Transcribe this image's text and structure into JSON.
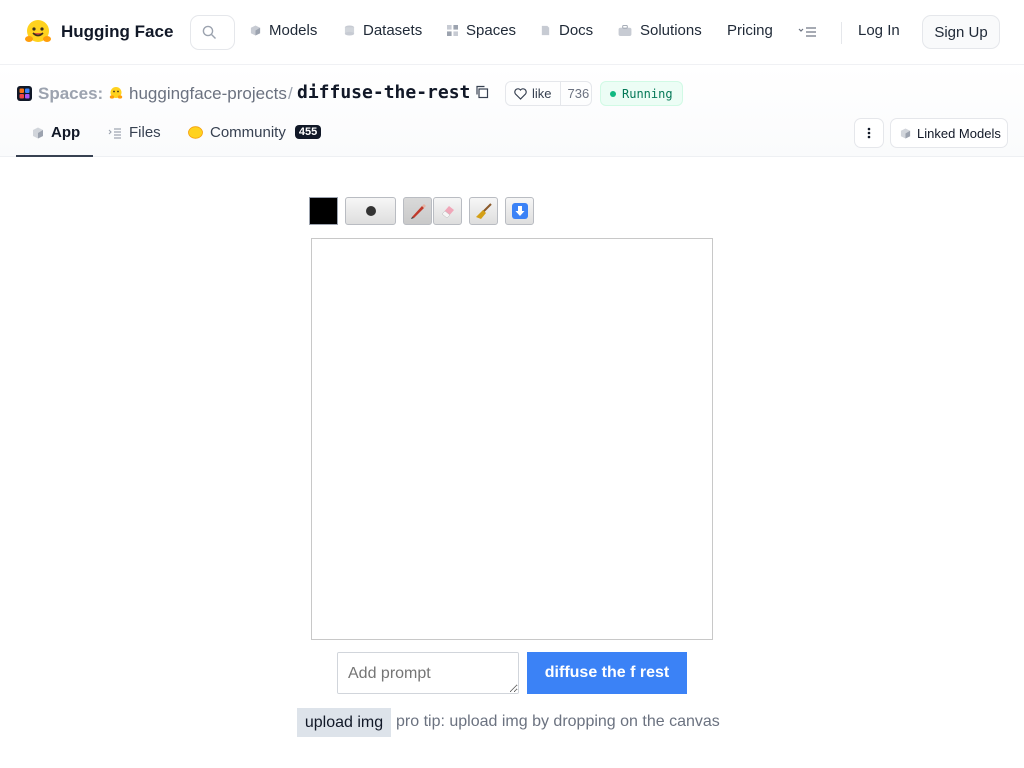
{
  "nav": {
    "brand": "Hugging Face",
    "items": [
      {
        "label": "Models",
        "icon": "cube-icon"
      },
      {
        "label": "Datasets",
        "icon": "database-icon"
      },
      {
        "label": "Spaces",
        "icon": "spaces-grid-icon"
      },
      {
        "label": "Docs",
        "icon": "docs-icon"
      },
      {
        "label": "Solutions",
        "icon": "briefcase-icon"
      },
      {
        "label": "Pricing"
      }
    ],
    "login": "Log In",
    "signup": "Sign Up"
  },
  "repo": {
    "section": "Spaces:",
    "owner": "huggingface-projects",
    "separator": "/",
    "name": "diffuse-the-rest",
    "like_label": "like",
    "like_count": "736",
    "status": "Running",
    "status_color": "#10b981"
  },
  "tabs": [
    {
      "label": "App",
      "active": true
    },
    {
      "label": "Files"
    },
    {
      "label": "Community",
      "badge": "455"
    }
  ],
  "linked_models": "Linked Models",
  "app": {
    "brush_color": "#000000",
    "tools": [
      "brush-size-icon",
      "pencil-icon",
      "eraser-icon",
      "broom-icon",
      "download-arrow-icon"
    ],
    "prompt_placeholder": "Add prompt",
    "submit_label": "diffuse the f rest",
    "submit_color": "#3b82f6",
    "upload_label": "upload img",
    "tip": "pro tip: upload img by dropping on the canvas"
  }
}
